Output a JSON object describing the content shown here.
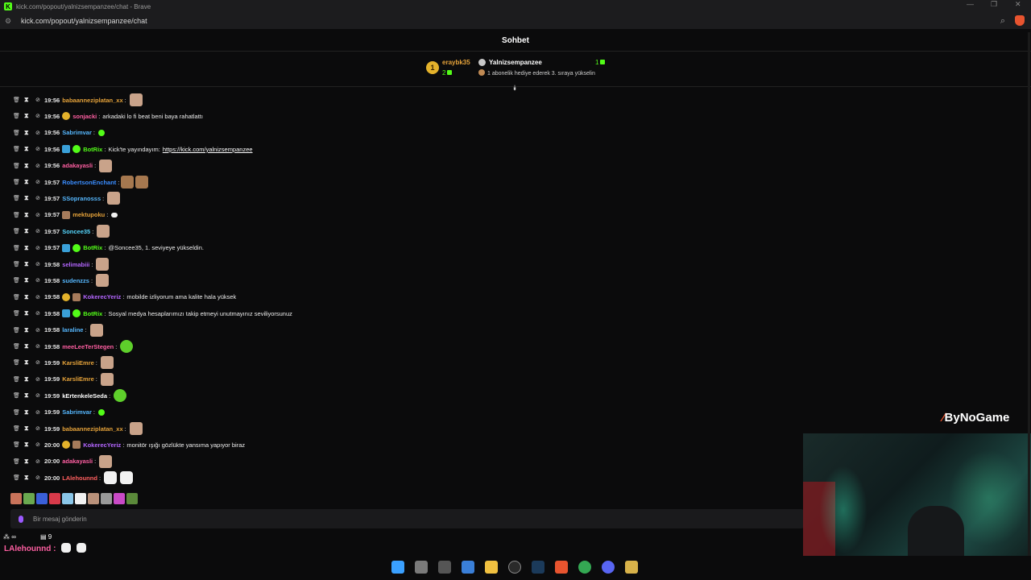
{
  "window": {
    "title": "kick.com/popout/yalnizsempanzee/chat - Brave",
    "url": "kick.com/popout/yalnizsempanzee/chat"
  },
  "chat": {
    "header": "Sohbet",
    "pinned": {
      "gifter": "eraybk35",
      "gifter_rank": "1",
      "gifter_count": "2",
      "channel": "Yalnizsempanzee",
      "gift_count": "1",
      "description": "1 abonelik hediye ederek 3. sıraya yükselin"
    },
    "messages": [
      {
        "time": "19:56",
        "badges": [],
        "user": "babaanneziplatan_xx",
        "color": "#e6a33a",
        "text": "",
        "emote": "emote"
      },
      {
        "time": "19:56",
        "badges": [
          "gold"
        ],
        "user": "sonjacki",
        "color": "#ff5fa2",
        "text": "arkadaki lo fi beat beni baya rahatlattı",
        "emote": ""
      },
      {
        "time": "19:56",
        "badges": [],
        "user": "Sabrimvar",
        "color": "#56b8ff",
        "text": "",
        "emote": "small"
      },
      {
        "time": "19:56",
        "badges": [
          "bot",
          "verified"
        ],
        "user": "BotRix",
        "color": "#53fc18",
        "text": "Kick'te yayındayım:",
        "link": "https://kick.com/yalnizsempanzee",
        "emote": ""
      },
      {
        "time": "19:56",
        "badges": [],
        "user": "adakayasli",
        "color": "#ff5fa2",
        "text": "",
        "emote": "emote"
      },
      {
        "time": "19:57",
        "badges": [],
        "user": "RobertsonEnchant",
        "color": "#3a8dff",
        "text": "",
        "emote": "pair"
      },
      {
        "time": "19:57",
        "badges": [],
        "user": "SSopranosss",
        "color": "#56b8ff",
        "text": "",
        "emote": "emote"
      },
      {
        "time": "19:57",
        "badges": [
          "sub"
        ],
        "user": "mektupoku",
        "color": "#e6a33a",
        "text": "",
        "emote": "speech"
      },
      {
        "time": "19:57",
        "badges": [],
        "user": "Soncee35",
        "color": "#56d8ff",
        "text": "",
        "emote": "emote"
      },
      {
        "time": "19:57",
        "badges": [
          "bot",
          "verified"
        ],
        "user": "BotRix",
        "color": "#53fc18",
        "text": "@Soncee35, 1. seviyeye yükseldin.",
        "emote": ""
      },
      {
        "time": "19:58",
        "badges": [],
        "user": "selimabiii",
        "color": "#b466ff",
        "text": "",
        "emote": "emote"
      },
      {
        "time": "19:58",
        "badges": [],
        "user": "sudenzzs",
        "color": "#56b8ff",
        "text": "",
        "emote": "emote"
      },
      {
        "time": "19:58",
        "badges": [
          "gold",
          "sub"
        ],
        "user": "KokerecYeriz",
        "color": "#b466ff",
        "text": "mobilde izliyorum ama kalite hala yüksek",
        "emote": ""
      },
      {
        "time": "19:58",
        "badges": [
          "bot",
          "verified"
        ],
        "user": "BotRix",
        "color": "#53fc18",
        "text": "Sosyal medya hesaplarımızı takip etmeyi unutmayınız seviliyorsunuz",
        "emote": ""
      },
      {
        "time": "19:58",
        "badges": [],
        "user": "laraline",
        "color": "#56b8ff",
        "text": "",
        "emote": "emote"
      },
      {
        "time": "19:58",
        "badges": [],
        "user": "meeLeeTerStegen",
        "color": "#ff5fa2",
        "text": "",
        "emote": "green"
      },
      {
        "time": "19:59",
        "badges": [],
        "user": "KarsliEmre",
        "color": "#e6a33a",
        "text": "",
        "emote": "emote"
      },
      {
        "time": "19:59",
        "badges": [],
        "user": "KarsliEmre",
        "color": "#e6a33a",
        "text": "",
        "emote": "emote"
      },
      {
        "time": "19:59",
        "badges": [],
        "user": "kErtenkeleSeda",
        "color": "#ffffff",
        "text": "",
        "emote": "green"
      },
      {
        "time": "19:59",
        "badges": [],
        "user": "Sabrimvar",
        "color": "#56b8ff",
        "text": "",
        "emote": "small"
      },
      {
        "time": "19:59",
        "badges": [],
        "user": "babaanneziplatan_xx",
        "color": "#e6a33a",
        "text": "",
        "emote": "emote"
      },
      {
        "time": "20:00",
        "badges": [
          "gold",
          "sub"
        ],
        "user": "KokerecYeriz",
        "color": "#b466ff",
        "text": "monitör ışığı gözlükte yansıma yapıyor biraz",
        "emote": ""
      },
      {
        "time": "20:00",
        "badges": [],
        "user": "adakayasli",
        "color": "#ff5fa2",
        "text": "",
        "emote": "emote"
      },
      {
        "time": "20:00",
        "badges": [],
        "user": "LAlehounnd",
        "color": "#ff5f5f",
        "text": "",
        "emote": "white2"
      }
    ],
    "input_placeholder": "Bir mesaj gönderin"
  },
  "overlay": {
    "stat_left": "∞",
    "stat_right": "9",
    "last_user": "LAlehounnd :"
  },
  "brand": {
    "name": "ByNoGame"
  },
  "colors": {
    "kick_green": "#53fc18",
    "background": "#0b0b0c"
  }
}
